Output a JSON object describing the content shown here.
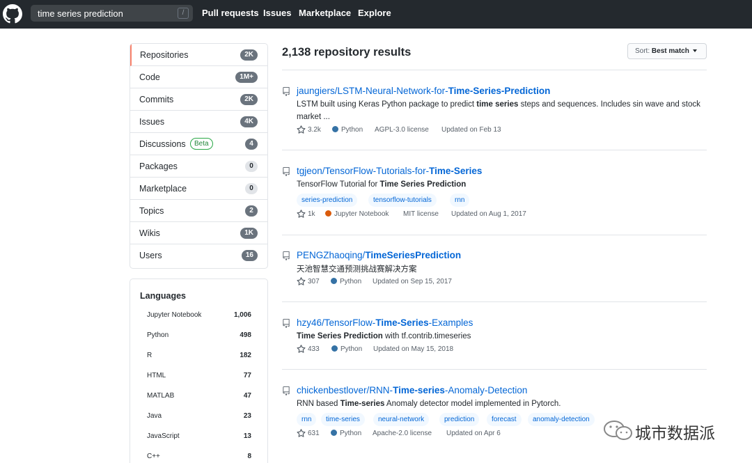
{
  "header": {
    "search_value": "time series prediction",
    "search_shortcut": "/",
    "nav": [
      "Pull requests",
      "Issues",
      "Marketplace",
      "Explore"
    ]
  },
  "menu": [
    {
      "label": "Repositories",
      "count": "2K"
    },
    {
      "label": "Code",
      "count": "1M+"
    },
    {
      "label": "Commits",
      "count": "2K"
    },
    {
      "label": "Issues",
      "count": "4K"
    },
    {
      "label": "Discussions",
      "count": "4",
      "badge": "Beta"
    },
    {
      "label": "Packages",
      "count": "0"
    },
    {
      "label": "Marketplace",
      "count": "0"
    },
    {
      "label": "Topics",
      "count": "2"
    },
    {
      "label": "Wikis",
      "count": "1K"
    },
    {
      "label": "Users",
      "count": "16"
    }
  ],
  "languages": {
    "title": "Languages",
    "items": [
      {
        "name": "Jupyter Notebook",
        "count": "1,006"
      },
      {
        "name": "Python",
        "count": "498"
      },
      {
        "name": "R",
        "count": "182"
      },
      {
        "name": "HTML",
        "count": "77"
      },
      {
        "name": "MATLAB",
        "count": "47"
      },
      {
        "name": "Java",
        "count": "23"
      },
      {
        "name": "JavaScript",
        "count": "13"
      },
      {
        "name": "C++",
        "count": "8"
      }
    ]
  },
  "results": {
    "count_label": "2,138 repository results",
    "sort_prefix": "Sort:",
    "sort_value": "Best match",
    "repos": [
      {
        "owner": "jaungiers/",
        "name_pre": "LSTM-Neural-Network-for-",
        "name_bold": "Time-Series-Prediction",
        "name_post": "",
        "desc_1": "LSTM built using Keras Python package to predict ",
        "desc_bold": "time series",
        "desc_2": " steps and sequences. Includes sin wave and stock market ...",
        "stars": "3.2k",
        "language": "Python",
        "license": "AGPL-3.0 license",
        "updated": "Updated on Feb 13",
        "tags": []
      },
      {
        "owner": "tgjeon/",
        "name_pre": "TensorFlow-Tutorials-for-",
        "name_bold": "Time-Series",
        "name_post": "",
        "desc_1": "TensorFlow Tutorial for ",
        "desc_bold": "Time Series Prediction",
        "desc_2": "",
        "stars": "1k",
        "language": "Jupyter Notebook",
        "license": "MIT license",
        "updated": "Updated on Aug 1, 2017",
        "tags": [
          "series-prediction",
          "tensorflow-tutorials",
          "rnn"
        ]
      },
      {
        "owner": "PENGZhaoqing/",
        "name_pre": "",
        "name_bold": "TimeSeriesPrediction",
        "name_post": "",
        "desc_1": "天池智慧交通预测挑战赛解决方案",
        "desc_bold": "",
        "desc_2": "",
        "stars": "307",
        "language": "Python",
        "license": "",
        "updated": "Updated on Sep 15, 2017",
        "tags": []
      },
      {
        "owner": "hzy46/",
        "name_pre": "TensorFlow-",
        "name_bold": "Time-Series",
        "name_post": "-Examples",
        "desc_1": "",
        "desc_bold": "Time Series Prediction",
        "desc_2": " with tf.contrib.timeseries",
        "stars": "433",
        "language": "Python",
        "license": "",
        "updated": "Updated on May 15, 2018",
        "tags": []
      },
      {
        "owner": "chickenbestlover/",
        "name_pre": "RNN-",
        "name_bold": "Time-series",
        "name_post": "-Anomaly-Detection",
        "desc_1": "RNN based ",
        "desc_bold": "Time-series",
        "desc_2": " Anomaly detector model implemented in Pytorch.",
        "stars": "631",
        "language": "Python",
        "license": "Apache-2.0 license",
        "updated": "Updated on Apr 6",
        "tags": [
          "rnn",
          "time-series",
          "neural-network",
          "prediction",
          "forecast",
          "anomaly-detection"
        ]
      }
    ]
  },
  "watermark": {
    "text": "城市数据派"
  },
  "colors": {
    "header_bg": "#24292e",
    "link": "#0366d6",
    "python": "#3572A5",
    "jupyter": "#DA5B0B",
    "selected_border": "#f9826c"
  }
}
